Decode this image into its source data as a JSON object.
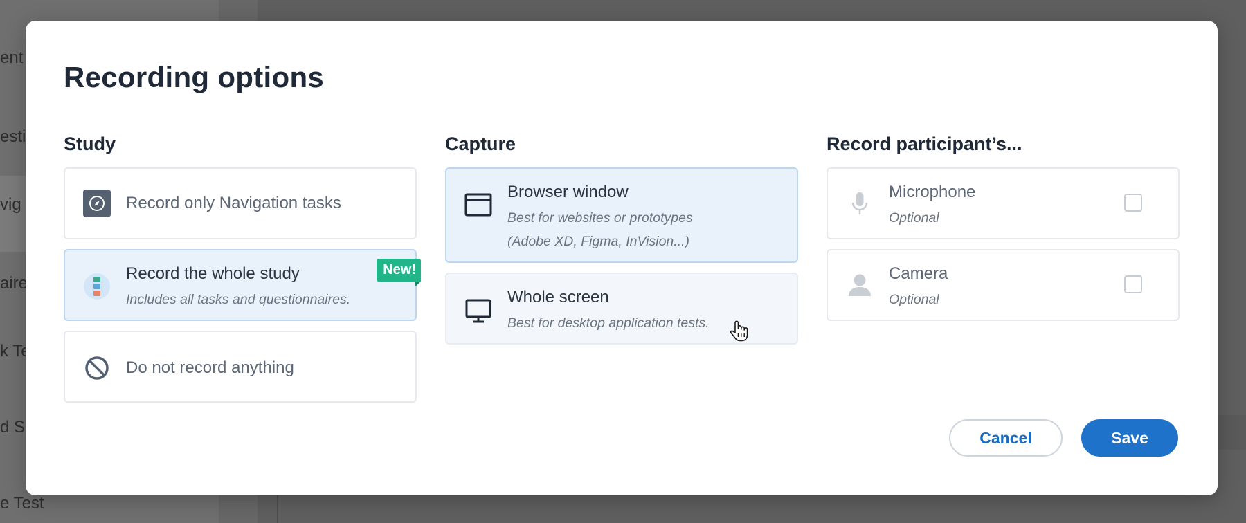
{
  "background": {
    "sidebar_items": [
      "ent",
      "esti",
      "vig",
      "aire",
      "k Te",
      "d S",
      "e Test"
    ]
  },
  "modal": {
    "title": "Recording options",
    "study": {
      "heading": "Study",
      "options": [
        {
          "label": "Record only Navigation tasks",
          "icon": "compass-icon"
        },
        {
          "label": "Record the whole study",
          "sublabel": "Includes all tasks and questionnaires.",
          "badge": "New!",
          "icon": "study-stack-icon",
          "selected": true
        },
        {
          "label": "Do not record anything",
          "icon": "prohibited-icon"
        }
      ]
    },
    "capture": {
      "heading": "Capture",
      "options": [
        {
          "label": "Browser window",
          "sublabel_line1": "Best for websites or prototypes",
          "sublabel_line2": "(Adobe XD, Figma, InVision...)",
          "icon": "browser-window-icon",
          "selected": true
        },
        {
          "label": "Whole screen",
          "sublabel": "Best for desktop application tests.",
          "icon": "monitor-icon",
          "hovered": true
        }
      ]
    },
    "record_participant": {
      "heading": "Record participant’s...",
      "options": [
        {
          "label": "Microphone",
          "sublabel": "Optional",
          "icon": "microphone-icon",
          "checked": false
        },
        {
          "label": "Camera",
          "sublabel": "Optional",
          "icon": "person-icon",
          "checked": false
        }
      ]
    },
    "buttons": {
      "cancel": "Cancel",
      "save": "Save"
    }
  },
  "colors": {
    "accent": "#1f72c9",
    "badge": "#22b58a",
    "selected_card": "#e9f2fb"
  }
}
